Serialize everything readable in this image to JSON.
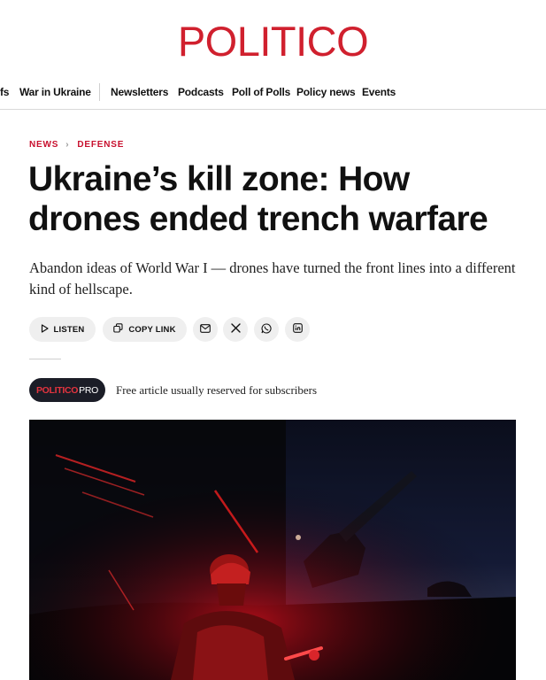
{
  "brand": {
    "logo": "POLITICO",
    "color": "#d0202e"
  },
  "nav": {
    "items": [
      "fs",
      "War in Ukraine",
      "Newsletters",
      "Podcasts",
      "Poll of Polls",
      "Policy news",
      "Events"
    ]
  },
  "breadcrumb": {
    "section": "NEWS",
    "subsection": "DEFENSE"
  },
  "article": {
    "headline": "Ukraine’s kill zone: How drones ended trench warfare",
    "dek": "Abandon ideas of World War I — drones have turned the front lines into a different kind of hellscape."
  },
  "share": {
    "listen_label": "LISTEN",
    "copy_link_label": "COPY LINK",
    "icons": [
      "envelope-icon",
      "x-icon",
      "whatsapp-icon",
      "linkedin-icon"
    ]
  },
  "pro": {
    "badge_politico": "POLITICO",
    "badge_pro": "PRO",
    "note": "Free article usually reserved for subscribers"
  },
  "hero_image": {
    "icon": "soldier-night-photo"
  }
}
